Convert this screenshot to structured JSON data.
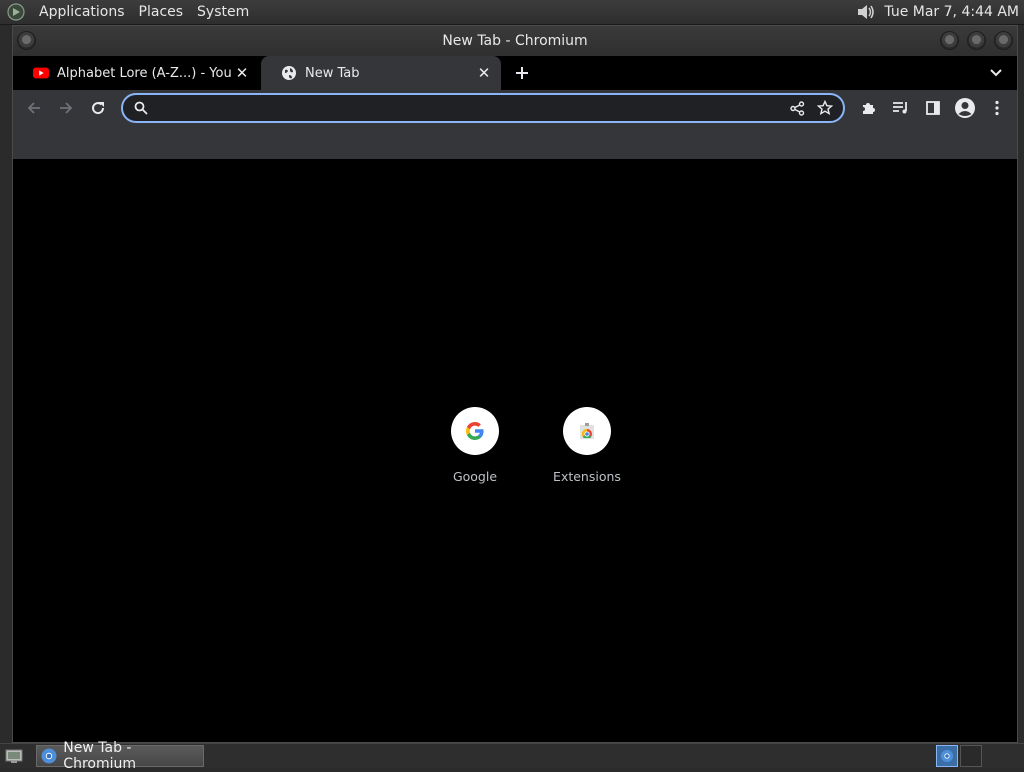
{
  "panel": {
    "menus": [
      "Applications",
      "Places",
      "System"
    ],
    "clock": "Tue Mar  7,  4:44 AM"
  },
  "window": {
    "title": "New Tab - Chromium"
  },
  "tabs": [
    {
      "title": "Alphabet Lore (A-Z...) - YouTube",
      "favicon": "youtube-icon",
      "active": false
    },
    {
      "title": "New Tab",
      "favicon": "globe-icon",
      "active": true
    }
  ],
  "omnibox": {
    "value": "",
    "placeholder": ""
  },
  "shortcuts": [
    {
      "label": "Google",
      "icon": "google-icon"
    },
    {
      "label": "Extensions",
      "icon": "extensions-icon"
    }
  ],
  "taskbar": {
    "item_label": "New Tab - Chromium"
  },
  "colors": {
    "accent": "#8ab4f8",
    "toolbar": "#35363a",
    "page_bg": "#000000"
  }
}
